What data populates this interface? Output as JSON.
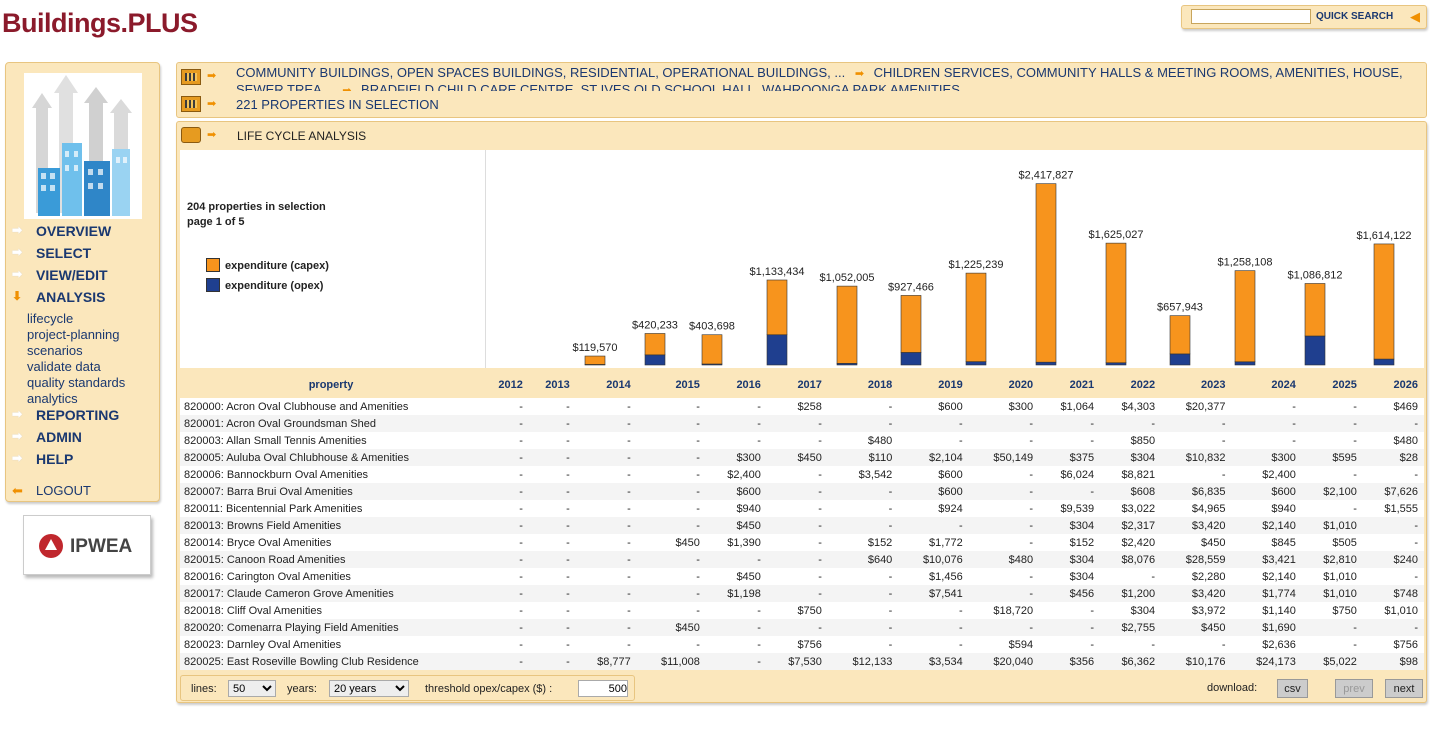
{
  "brand": "Buildings.PLUS",
  "quick_search": {
    "label": "QUICK SEARCH",
    "value": ""
  },
  "nav": {
    "overview": "OVERVIEW",
    "select": "SELECT",
    "view_edit": "VIEW/EDIT",
    "analysis": "ANALYSIS",
    "analysis_items": [
      "lifecycle",
      "project-planning",
      "scenarios",
      "validate data",
      "quality standards",
      "analytics"
    ],
    "reporting": "REPORTING",
    "admin": "ADMIN",
    "help": "HELP",
    "logout": "LOGOUT"
  },
  "partner_logo": "IPWEA",
  "breadcrumb": {
    "line1": "COMMUNITY BUILDINGS, OPEN SPACES BUILDINGS, RESIDENTIAL, OPERATIONAL BUILDINGS, ...",
    "line1b": "CHILDREN SERVICES, COMMUNITY HALLS & MEETING ROOMS, AMENITIES, HOUSE, SEWER TREA...",
    "line1c": "BRADFIELD CHILD CARE CENTRE, ST IVES OLD SCHOOL HALL, WAHROONGA PARK AMENITIES, ...",
    "line2": "221 PROPERTIES IN SELECTION",
    "panel_title": "LIFE CYCLE ANALYSIS"
  },
  "selection": {
    "count_text": "204 properties in selection",
    "page_text": "page 1 of 5"
  },
  "colors": {
    "capex": "#f7941d",
    "opex": "#1f3f8f"
  },
  "chart_data": {
    "type": "bar",
    "categories": [
      "2012",
      "2013",
      "2014",
      "2015",
      "2016",
      "2017",
      "2018",
      "2019",
      "2020",
      "2021",
      "2022",
      "2023",
      "2024",
      "2025",
      "2026"
    ],
    "series": [
      {
        "name": "expenditure (capex)",
        "values": [
          0,
          0,
          112000,
          285000,
          390000,
          730000,
          1030000,
          760000,
          1180000,
          2380000,
          1595000,
          510000,
          1215000,
          700000,
          1535000
        ]
      },
      {
        "name": "expenditure (opex)",
        "values": [
          0,
          0,
          7570,
          135233,
          13698,
          403434,
          22005,
          167466,
          45239,
          37827,
          30027,
          147943,
          43108,
          386812,
          79122
        ]
      }
    ],
    "labels": [
      "",
      "",
      "$119,570",
      "$420,233",
      "$403,698",
      "$1,133,434",
      "$1,052,005",
      "$927,466",
      "$1,225,239",
      "$2,417,827",
      "$1,625,027",
      "$657,943",
      "$1,258,108",
      "$1,086,812",
      "$1,614,122"
    ],
    "ylim": [
      0,
      2600000
    ]
  },
  "table": {
    "header": "property",
    "years": [
      "2012",
      "2013",
      "2014",
      "2015",
      "2016",
      "2017",
      "2018",
      "2019",
      "2020",
      "2021",
      "2022",
      "2023",
      "2024",
      "2025",
      "2026"
    ],
    "rows": [
      {
        "name": "820000: Acron Oval Clubhouse and Amenities",
        "v": [
          "-",
          "-",
          "-",
          "-",
          "-",
          "$258",
          "-",
          "$600",
          "$300",
          "$1,064",
          "$4,303",
          "$20,377",
          "-",
          "-",
          "$469"
        ]
      },
      {
        "name": "820001: Acron Oval Groundsman Shed",
        "v": [
          "-",
          "-",
          "-",
          "-",
          "-",
          "-",
          "-",
          "-",
          "-",
          "-",
          "-",
          "-",
          "-",
          "-",
          "-"
        ]
      },
      {
        "name": "820003: Allan Small Tennis Amenities",
        "v": [
          "-",
          "-",
          "-",
          "-",
          "-",
          "-",
          "$480",
          "-",
          "-",
          "-",
          "$850",
          "-",
          "-",
          "-",
          "$480"
        ]
      },
      {
        "name": "820005: Auluba Oval Chlubhouse & Amenities",
        "v": [
          "-",
          "-",
          "-",
          "-",
          "$300",
          "$450",
          "$110",
          "$2,104",
          "$50,149",
          "$375",
          "$304",
          "$10,832",
          "$300",
          "$595",
          "$28"
        ]
      },
      {
        "name": "820006: Bannockburn Oval Amenities",
        "v": [
          "-",
          "-",
          "-",
          "-",
          "$2,400",
          "-",
          "$3,542",
          "$600",
          "-",
          "$6,024",
          "$8,821",
          "-",
          "$2,400",
          "-",
          "-"
        ]
      },
      {
        "name": "820007: Barra Brui Oval Amenities",
        "v": [
          "-",
          "-",
          "-",
          "-",
          "$600",
          "-",
          "-",
          "$600",
          "-",
          "-",
          "$608",
          "$6,835",
          "$600",
          "$2,100",
          "$7,626"
        ]
      },
      {
        "name": "820011: Bicentennial Park Amenities",
        "v": [
          "-",
          "-",
          "-",
          "-",
          "$940",
          "-",
          "-",
          "$924",
          "-",
          "$9,539",
          "$3,022",
          "$4,965",
          "$940",
          "-",
          "$1,555"
        ]
      },
      {
        "name": "820013: Browns Field Amenities",
        "v": [
          "-",
          "-",
          "-",
          "-",
          "$450",
          "-",
          "-",
          "-",
          "-",
          "$304",
          "$2,317",
          "$3,420",
          "$2,140",
          "$1,010",
          "-"
        ]
      },
      {
        "name": "820014: Bryce Oval Amenities",
        "v": [
          "-",
          "-",
          "-",
          "$450",
          "$1,390",
          "-",
          "$152",
          "$1,772",
          "-",
          "$152",
          "$2,420",
          "$450",
          "$845",
          "$505",
          "-"
        ]
      },
      {
        "name": "820015: Canoon Road Amenities",
        "v": [
          "-",
          "-",
          "-",
          "-",
          "-",
          "-",
          "$640",
          "$10,076",
          "$480",
          "$304",
          "$8,076",
          "$28,559",
          "$3,421",
          "$2,810",
          "$240"
        ]
      },
      {
        "name": "820016: Carington Oval Amenities",
        "v": [
          "-",
          "-",
          "-",
          "-",
          "$450",
          "-",
          "-",
          "$1,456",
          "-",
          "$304",
          "-",
          "$2,280",
          "$2,140",
          "$1,010",
          "-"
        ]
      },
      {
        "name": "820017: Claude Cameron Grove Amenities",
        "v": [
          "-",
          "-",
          "-",
          "-",
          "$1,198",
          "-",
          "-",
          "$7,541",
          "-",
          "$456",
          "$1,200",
          "$3,420",
          "$1,774",
          "$1,010",
          "$748"
        ]
      },
      {
        "name": "820018: Cliff Oval Amenities",
        "v": [
          "-",
          "-",
          "-",
          "-",
          "-",
          "$750",
          "-",
          "-",
          "$18,720",
          "-",
          "$304",
          "$3,972",
          "$1,140",
          "$750",
          "$1,010"
        ]
      },
      {
        "name": "820020: Comenarra Playing Field Amenities",
        "v": [
          "-",
          "-",
          "-",
          "$450",
          "-",
          "-",
          "-",
          "-",
          "-",
          "-",
          "$2,755",
          "$450",
          "$1,690",
          "-",
          "-"
        ]
      },
      {
        "name": "820023: Darnley Oval Amenities",
        "v": [
          "-",
          "-",
          "-",
          "-",
          "-",
          "$756",
          "-",
          "-",
          "$594",
          "-",
          "-",
          "-",
          "$2,636",
          "-",
          "$756"
        ]
      },
      {
        "name": "820025: East Roseville Bowling Club Residence",
        "v": [
          "-",
          "-",
          "$8,777",
          "$11,008",
          "-",
          "$7,530",
          "$12,133",
          "$3,534",
          "$20,040",
          "$356",
          "$6,362",
          "$10,176",
          "$24,173",
          "$5,022",
          "$98"
        ]
      }
    ]
  },
  "footer": {
    "lines_label": "lines:",
    "lines_value": "50",
    "years_label": "years:",
    "years_value": "20 years",
    "threshold_label": "threshold opex/capex ($) :",
    "threshold_value": "500",
    "download_label": "download:",
    "csv": "csv",
    "prev": "prev",
    "next": "next"
  }
}
